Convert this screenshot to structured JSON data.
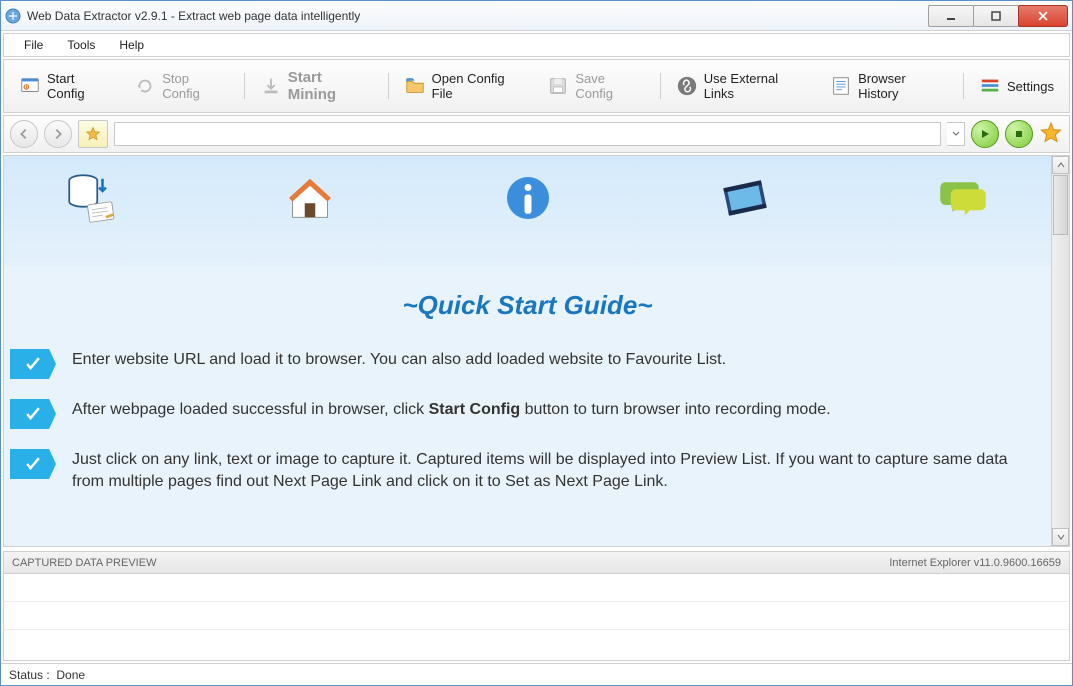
{
  "window": {
    "title": "Web Data Extractor v2.9.1 -  Extract web page data intelligently"
  },
  "menu": {
    "file": "File",
    "tools": "Tools",
    "help": "Help"
  },
  "toolbar": {
    "start_config": "Start Config",
    "stop_config": "Stop Config",
    "start_mining": "Start Mining",
    "open_config": "Open Config File",
    "save_config": "Save Config",
    "external_links": "Use External Links",
    "browser_history": "Browser History",
    "settings": "Settings"
  },
  "guide": {
    "title": "~Quick Start Guide~",
    "step1": "Enter website URL and load it to browser. You can also add loaded website to Favourite List.",
    "step2_pre": "After webpage loaded successful in browser, click ",
    "step2_bold": "Start Config",
    "step2_post": " button to turn browser into recording mode.",
    "step3": "Just click on any link, text or image to capture it. Captured items will be displayed into Preview List. If you want to capture same data from multiple pages find out Next Page Link and click on it to Set as Next Page Link."
  },
  "preview": {
    "header": "CAPTURED DATA PREVIEW",
    "browser_info": "Internet Explorer v11.0.9600.16659"
  },
  "status": {
    "label": "Status :",
    "value": "Done"
  }
}
